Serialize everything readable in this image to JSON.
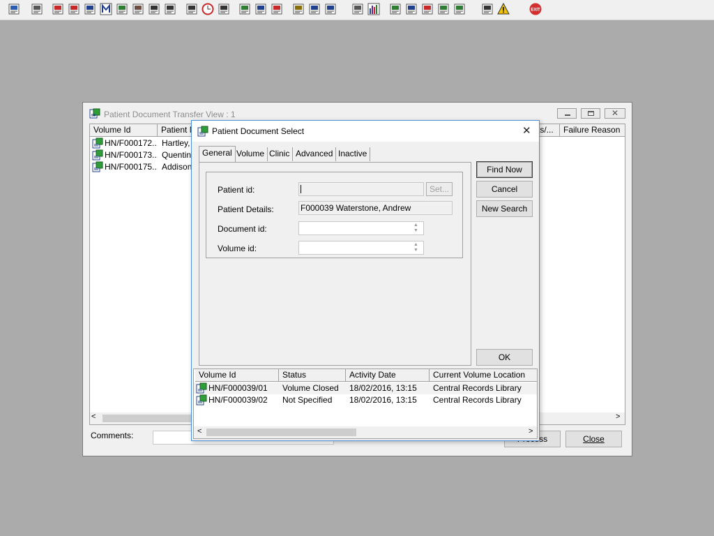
{
  "toolbar": {
    "icons": [
      {
        "name": "user-icon",
        "color": "#2a5db0"
      },
      {
        "name": "printer-icon",
        "color": "#555555"
      },
      {
        "name": "books-icon",
        "color": "#c62828"
      },
      {
        "name": "file-edit-icon",
        "color": "#c62828"
      },
      {
        "name": "card-index-icon",
        "color": "#1f3f8f"
      },
      {
        "name": "mail-m-icon",
        "color": "#1f3f8f"
      },
      {
        "name": "person-icon",
        "color": "#2e7d32"
      },
      {
        "name": "notepad-icon",
        "color": "#6d4c41"
      },
      {
        "name": "phone-icon",
        "color": "#333333"
      },
      {
        "name": "phone-alt-icon",
        "color": "#333333"
      },
      {
        "name": "search-doc-icon",
        "color": "#333333"
      },
      {
        "name": "clock-icon",
        "color": "#c62828"
      },
      {
        "name": "monitor-icon",
        "color": "#333333"
      },
      {
        "name": "chart-doc-icon",
        "color": "#2e7d32"
      },
      {
        "name": "form-icon",
        "color": "#1f3f8f"
      },
      {
        "name": "globe-icon",
        "color": "#c62828"
      },
      {
        "name": "list-icon",
        "color": "#8a6d00"
      },
      {
        "name": "car-icon",
        "color": "#1f3f8f"
      },
      {
        "name": "people-icon",
        "color": "#1f3f8f"
      },
      {
        "name": "page-icon",
        "color": "#555555"
      },
      {
        "name": "bar-chart-icon",
        "color": "#6a1b9a"
      },
      {
        "name": "world-icon",
        "color": "#2e7d32"
      },
      {
        "name": "check-doc-icon",
        "color": "#1f3f8f"
      },
      {
        "name": "route-icon",
        "color": "#c62828"
      },
      {
        "name": "transfer-icon",
        "color": "#2e7d32"
      },
      {
        "name": "transfer-alt-icon",
        "color": "#2e7d32"
      },
      {
        "name": "swap-icon",
        "color": "#333333"
      },
      {
        "name": "warning-icon",
        "color": "#f2c200"
      },
      {
        "name": "exit-icon",
        "color": "#d32f2f"
      }
    ],
    "exit_text": "EXIT"
  },
  "bg_window": {
    "title": "Patient Document Transfer View : 1",
    "columns": [
      "Volume Id",
      "Patient N",
      "ts/...",
      "Failure Reason"
    ],
    "rows": [
      {
        "volume_id": "HN/F000172...",
        "patient": "Hartley, J"
      },
      {
        "volume_id": "HN/F000173...",
        "patient": "Quentin,"
      },
      {
        "volume_id": "HN/F000175...",
        "patient": "Addison,"
      }
    ],
    "comments_label": "Comments:",
    "process_label": "Process",
    "close_label": "Close"
  },
  "dialog": {
    "title": "Patient Document Select",
    "tabs": [
      "General",
      "Volume",
      "Clinic",
      "Advanced",
      "Inactive"
    ],
    "active_tab": "General",
    "fields": {
      "patient_id_label": "Patient id:",
      "patient_id_value": "",
      "set_label": "Set...",
      "patient_details_label": "Patient Details:",
      "patient_details_value": "F000039 Waterstone, Andrew",
      "document_id_label": "Document id:",
      "document_id_value": "",
      "volume_id_label": "Volume id:",
      "volume_id_value": ""
    },
    "buttons": {
      "find_now": "Find Now",
      "cancel": "Cancel",
      "new_search": "New Search",
      "ok": "OK"
    },
    "results": {
      "columns": [
        "Volume Id",
        "Status",
        "Activity Date",
        "Current Volume Location"
      ],
      "rows": [
        {
          "volume_id": "HN/F000039/01",
          "status": "Volume Closed",
          "date": "18/02/2016, 13:15",
          "location": "Central Records Library"
        },
        {
          "volume_id": "HN/F000039/02",
          "status": "Not Specified",
          "date": "18/02/2016, 13:15",
          "location": "Central Records Library"
        }
      ]
    }
  }
}
